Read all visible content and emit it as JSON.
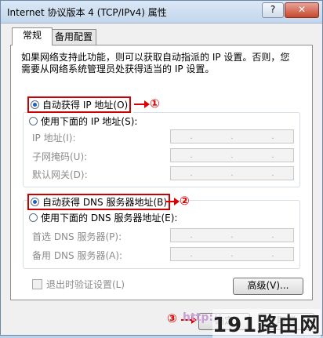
{
  "window": {
    "title": "Internet 协议版本 4 (TCP/IPv4) 属性",
    "help_label": "?",
    "close_label": "✕"
  },
  "tabs": [
    {
      "label": "常规",
      "active": true
    },
    {
      "label": "备用配置",
      "active": false
    }
  ],
  "description": "如果网络支持此功能，则可以获取自动指派的 IP 设置。否则，您需要从网络系统管理员处获得适当的 IP 设置。",
  "ip_section": {
    "auto_label": "自动获得 IP 地址(O)",
    "manual_label": "使用下面的 IP 地址(S):",
    "selected": "auto",
    "fields": [
      {
        "label": "IP 地址(I):"
      },
      {
        "label": "子网掩码(U):"
      },
      {
        "label": "默认网关(D):"
      }
    ]
  },
  "dns_section": {
    "auto_label": "自动获得 DNS 服务器地址(B)",
    "manual_label": "使用下面的 DNS 服务器地址(E):",
    "selected": "auto",
    "fields": [
      {
        "label": "首选 DNS 服务器(P):"
      },
      {
        "label": "备用 DNS 服务器(A):"
      }
    ]
  },
  "validate_label": "退出时验证设置(L)",
  "advanced_label": "高级(V)...",
  "ok_label": "确定",
  "cancel_label": "取消",
  "annotations": [
    "①",
    "②",
    "③"
  ],
  "watermark": {
    "url": "http://",
    "brand": "191路由网"
  },
  "colors": {
    "annotation": "#dd0000",
    "titlebar": "#c3d6ec"
  }
}
